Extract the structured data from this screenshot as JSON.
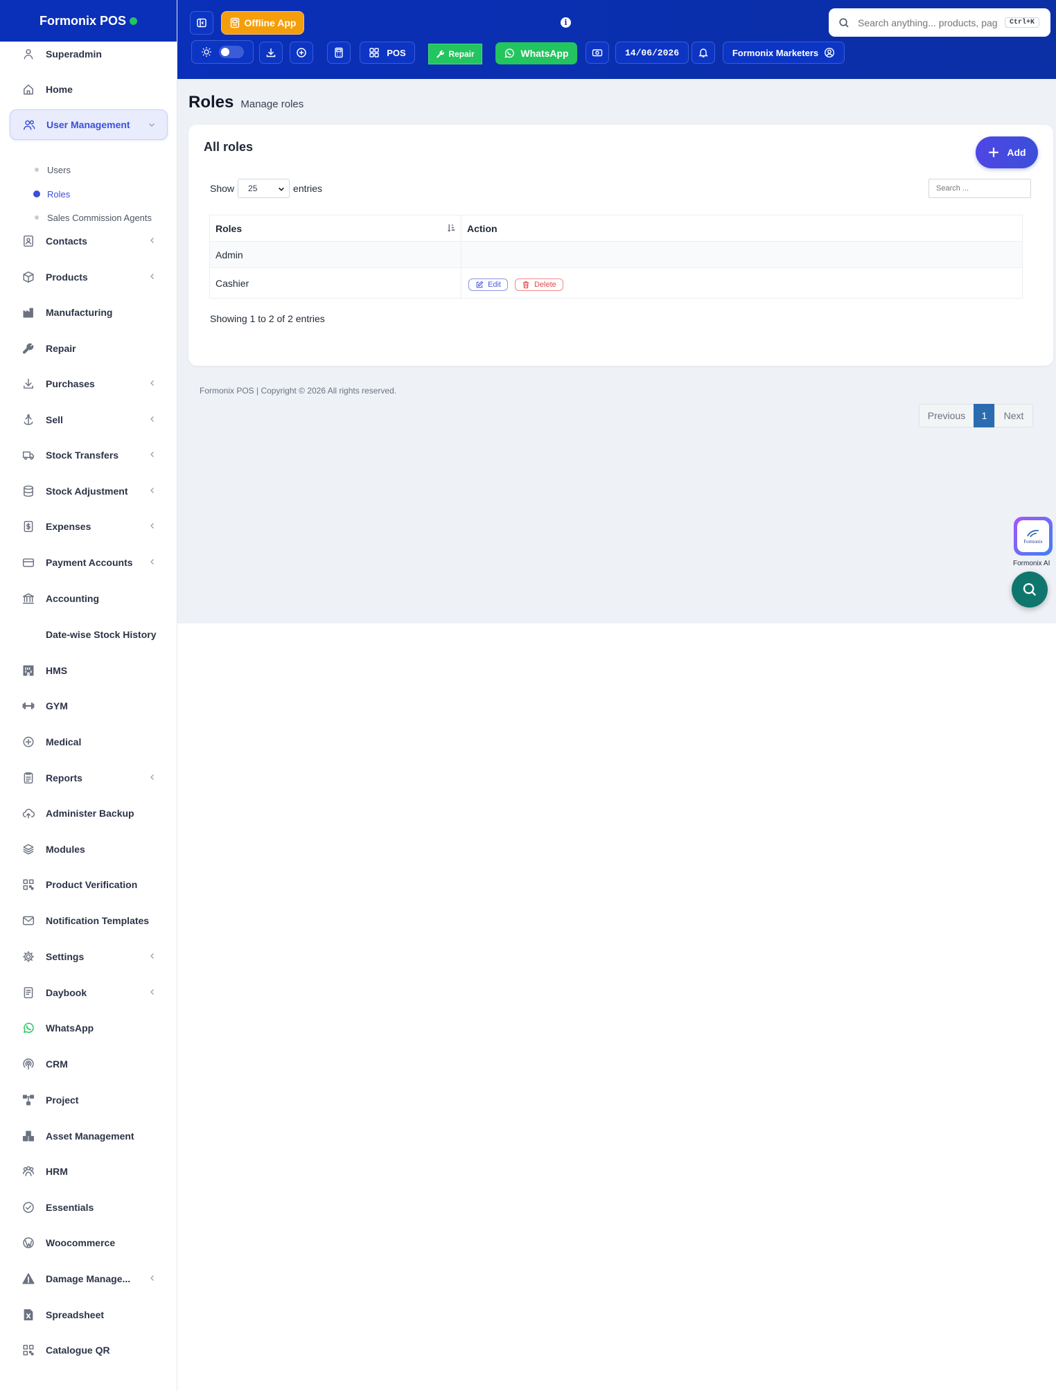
{
  "brand": {
    "name": "Formonix POS"
  },
  "sidebar": {
    "items": [
      {
        "label": "Superadmin",
        "icon": "user-icon",
        "chevron": false
      },
      {
        "label": "Home",
        "icon": "home-icon",
        "chevron": false
      },
      {
        "label": "User Management",
        "icon": "users-icon",
        "chevron": true,
        "active": true
      },
      {
        "label": "Contacts",
        "icon": "contact-icon",
        "chevron": true
      },
      {
        "label": "Products",
        "icon": "box-icon",
        "chevron": true
      },
      {
        "label": "Manufacturing",
        "icon": "factory-icon",
        "chevron": false
      },
      {
        "label": "Repair",
        "icon": "wrench-icon",
        "chevron": false
      },
      {
        "label": "Purchases",
        "icon": "download-icon",
        "chevron": true
      },
      {
        "label": "Sell",
        "icon": "upload-icon",
        "chevron": true
      },
      {
        "label": "Stock Transfers",
        "icon": "truck-icon",
        "chevron": true
      },
      {
        "label": "Stock Adjustment",
        "icon": "database-icon",
        "chevron": true
      },
      {
        "label": "Expenses",
        "icon": "receipt-icon",
        "chevron": true
      },
      {
        "label": "Payment Accounts",
        "icon": "card-icon",
        "chevron": true
      },
      {
        "label": "Accounting",
        "icon": "bank-icon",
        "chevron": false
      },
      {
        "label": "Date-wise Stock History",
        "icon": "",
        "chevron": false
      },
      {
        "label": "HMS",
        "icon": "hotel-icon",
        "chevron": false
      },
      {
        "label": "GYM",
        "icon": "dumbbell-icon",
        "chevron": false
      },
      {
        "label": "Medical",
        "icon": "medical-icon",
        "chevron": false
      },
      {
        "label": "Reports",
        "icon": "report-icon",
        "chevron": true
      },
      {
        "label": "Administer Backup",
        "icon": "cloud-upload-icon",
        "chevron": false
      },
      {
        "label": "Modules",
        "icon": "layers-icon",
        "chevron": false
      },
      {
        "label": "Product Verification",
        "icon": "qr-icon",
        "chevron": false
      },
      {
        "label": "Notification Templates",
        "icon": "mail-icon",
        "chevron": false
      },
      {
        "label": "Settings",
        "icon": "gear-icon",
        "chevron": true
      },
      {
        "label": "Daybook",
        "icon": "book-icon",
        "chevron": true
      },
      {
        "label": "WhatsApp",
        "icon": "whatsapp-icon",
        "chevron": false
      },
      {
        "label": "CRM",
        "icon": "broadcast-icon",
        "chevron": false
      },
      {
        "label": "Project",
        "icon": "sitemap-icon",
        "chevron": false
      },
      {
        "label": "Asset Management",
        "icon": "boxes-icon",
        "chevron": false
      },
      {
        "label": "HRM",
        "icon": "people-icon",
        "chevron": false
      },
      {
        "label": "Essentials",
        "icon": "check-circle-icon",
        "chevron": false
      },
      {
        "label": "Woocommerce",
        "icon": "wordpress-icon",
        "chevron": false
      },
      {
        "label": "Damage Manage...",
        "icon": "warning-icon",
        "chevron": true
      },
      {
        "label": "Spreadsheet",
        "icon": "excel-icon",
        "chevron": false
      },
      {
        "label": "Catalogue QR",
        "icon": "qr-icon",
        "chevron": false
      }
    ],
    "subitems": [
      {
        "label": "Users",
        "current": false
      },
      {
        "label": "Roles",
        "current": true
      },
      {
        "label": "Sales Commission Agents",
        "current": false
      }
    ]
  },
  "header": {
    "offline_label": "Offline App",
    "search_placeholder": "Search anything... products, pag",
    "shortcut": "Ctrl+K",
    "pos_label": "POS",
    "repair_label": "Repair",
    "whatsapp_label": "WhatsApp",
    "date": "14/06/2026",
    "business": "Formonix Marketers"
  },
  "page": {
    "title": "Roles",
    "subtitle": "Manage roles"
  },
  "card": {
    "title": "All roles",
    "add_label": "Add",
    "show_label": "Show",
    "entries_label": "entries",
    "page_size": "25",
    "search_placeholder": "Search ...",
    "columns": [
      "Roles",
      "Action"
    ],
    "rows": [
      {
        "role": "Admin",
        "actions": false
      },
      {
        "role": "Cashier",
        "actions": true
      }
    ],
    "edit_label": "Edit",
    "delete_label": "Delete",
    "info": "Showing 1 to 2 of 2 entries",
    "pagination": {
      "previous": "Previous",
      "current": "1",
      "next": "Next"
    }
  },
  "footer": {
    "text": "Formonix POS | Copyright © 2026 All rights reserved."
  },
  "ai": {
    "label": "Formonix AI",
    "logo_text": "Formonix"
  },
  "colors": {
    "primary": "#0a2fb8",
    "accent": "#3b4fd9",
    "orange": "#f59e0b",
    "green": "#22c55e",
    "teal": "#0f766e"
  }
}
